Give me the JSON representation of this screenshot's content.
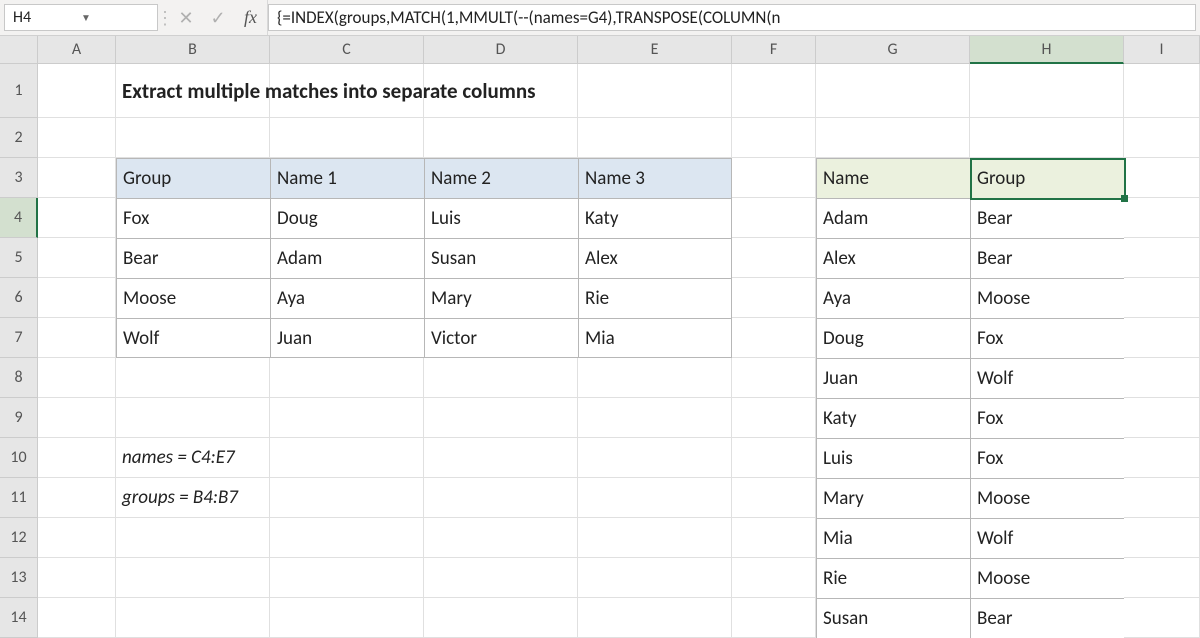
{
  "name_box": "H4",
  "formula": "{=INDEX(groups,MATCH(1,MMULT(--(names=G4),TRANSPOSE(COLUMN(n",
  "fx_label": "fx",
  "columns": [
    "A",
    "B",
    "C",
    "D",
    "E",
    "F",
    "G",
    "H",
    "I"
  ],
  "selected_col": "H",
  "selected_row": "4",
  "rows": [
    "1",
    "2",
    "3",
    "4",
    "5",
    "6",
    "7",
    "8",
    "9",
    "10",
    "11",
    "12",
    "13",
    "14"
  ],
  "title": "Extract multiple matches into separate columns",
  "left_table": {
    "headers": [
      "Group",
      "Name 1",
      "Name 2",
      "Name 3"
    ],
    "rows": [
      [
        "Fox",
        "Doug",
        "Luis",
        "Katy"
      ],
      [
        "Bear",
        "Adam",
        "Susan",
        "Alex"
      ],
      [
        "Moose",
        "Aya",
        "Mary",
        "Rie"
      ],
      [
        "Wolf",
        "Juan",
        "Victor",
        "Mia"
      ]
    ]
  },
  "right_table": {
    "headers": [
      "Name",
      "Group"
    ],
    "rows": [
      [
        "Adam",
        "Bear"
      ],
      [
        "Alex",
        "Bear"
      ],
      [
        "Aya",
        "Moose"
      ],
      [
        "Doug",
        "Fox"
      ],
      [
        "Juan",
        "Wolf"
      ],
      [
        "Katy",
        "Fox"
      ],
      [
        "Luis",
        "Fox"
      ],
      [
        "Mary",
        "Moose"
      ],
      [
        "Mia",
        "Wolf"
      ],
      [
        "Rie",
        "Moose"
      ],
      [
        "Susan",
        "Bear"
      ]
    ]
  },
  "notes": {
    "line1": "names = C4:E7",
    "line2": "groups = B4:B7"
  }
}
